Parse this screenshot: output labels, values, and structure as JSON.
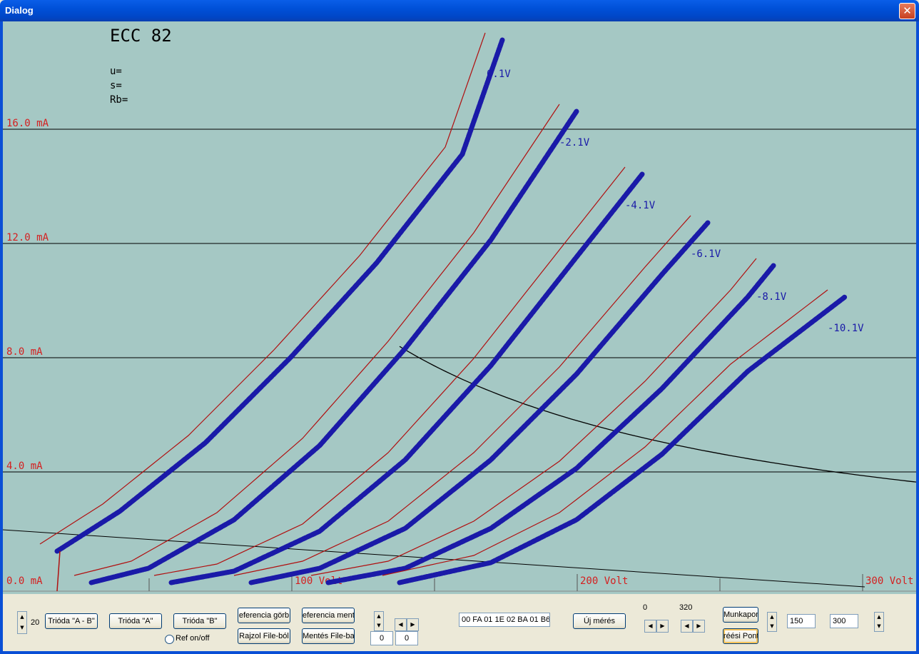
{
  "window": {
    "title": "Dialog",
    "close_glyph": "✕"
  },
  "plot": {
    "tube_name": "ECC 82",
    "params": [
      "u=",
      "s=",
      "Rb="
    ],
    "y_axis_labels": [
      "16.0 mA",
      "12.0 mA",
      "8.0 mA",
      "4.0 mA",
      "0.0 mA"
    ],
    "x_axis_labels": [
      "100 Volt",
      "200 Volt",
      "300 Volt"
    ],
    "curve_labels": [
      "0.1V",
      "-2.1V",
      "-4.1V",
      "-6.1V",
      "-8.1V",
      "-10.1V"
    ],
    "colors": {
      "background": "#a5c8c4",
      "grid": "#000000",
      "axis_text": "#d42020",
      "measured": "#1a1aa8",
      "reference": "#b01010"
    }
  },
  "chart_data": {
    "type": "line",
    "title": "ECC 82",
    "xlabel": "Volt",
    "ylabel": "mA",
    "xlim": [
      0,
      300
    ],
    "ylim": [
      0,
      16
    ],
    "grid": true,
    "series": [
      {
        "name": "0.1V",
        "x": [
          18,
          40,
          70,
          100,
          130,
          160,
          174
        ],
        "y": [
          1.2,
          2.6,
          5.0,
          8.0,
          11.3,
          15.1,
          19.1
        ]
      },
      {
        "name": "-2.1V",
        "x": [
          30,
          50,
          80,
          110,
          140,
          170,
          200
        ],
        "y": [
          0.1,
          0.6,
          2.3,
          4.9,
          8.3,
          12.1,
          16.6
        ]
      },
      {
        "name": "-4.1V",
        "x": [
          58,
          80,
          110,
          140,
          170,
          200,
          223
        ],
        "y": [
          0.1,
          0.5,
          1.9,
          4.4,
          7.7,
          11.5,
          14.4
        ]
      },
      {
        "name": "-6.1V",
        "x": [
          86,
          110,
          140,
          170,
          200,
          230,
          246
        ],
        "y": [
          0.1,
          0.6,
          2.0,
          4.4,
          7.4,
          10.9,
          12.7
        ]
      },
      {
        "name": "-8.1V",
        "x": [
          113,
          140,
          170,
          200,
          230,
          260,
          269
        ],
        "y": [
          0.1,
          0.6,
          2.0,
          4.1,
          6.9,
          10.1,
          11.2
        ]
      },
      {
        "name": "-10.1V",
        "x": [
          138,
          170,
          200,
          230,
          260,
          294
        ],
        "y": [
          0.1,
          0.8,
          2.3,
          4.6,
          7.5,
          10.1
        ]
      }
    ],
    "reference_series_offset_volt": -6
  },
  "controls": {
    "spin_value": "20",
    "btn_trioda_ab": "Trióda \"A - B\"",
    "btn_trioda_a": "Trióda  \"A\"",
    "btn_trioda_b": "Trióda  \"B\"",
    "btn_ref_gorbe": "eferencia görb",
    "btn_ref_mentes": "eferencia ment",
    "btn_rajzol": "Rajzol File-ból",
    "btn_mentes": "Mentés File-ba",
    "radio_label": "Ref on/off",
    "num_a": "0",
    "num_b": "0",
    "hex_field": "00 FA 01 1E 02 BA 01 B6",
    "btn_uj_meres": "Új mérés",
    "range_min": "0",
    "range_max": "320",
    "btn_munkapont": "Munkapon",
    "btn_meresi_pont": "réési Pont",
    "field_150": "150",
    "field_300": "300"
  }
}
